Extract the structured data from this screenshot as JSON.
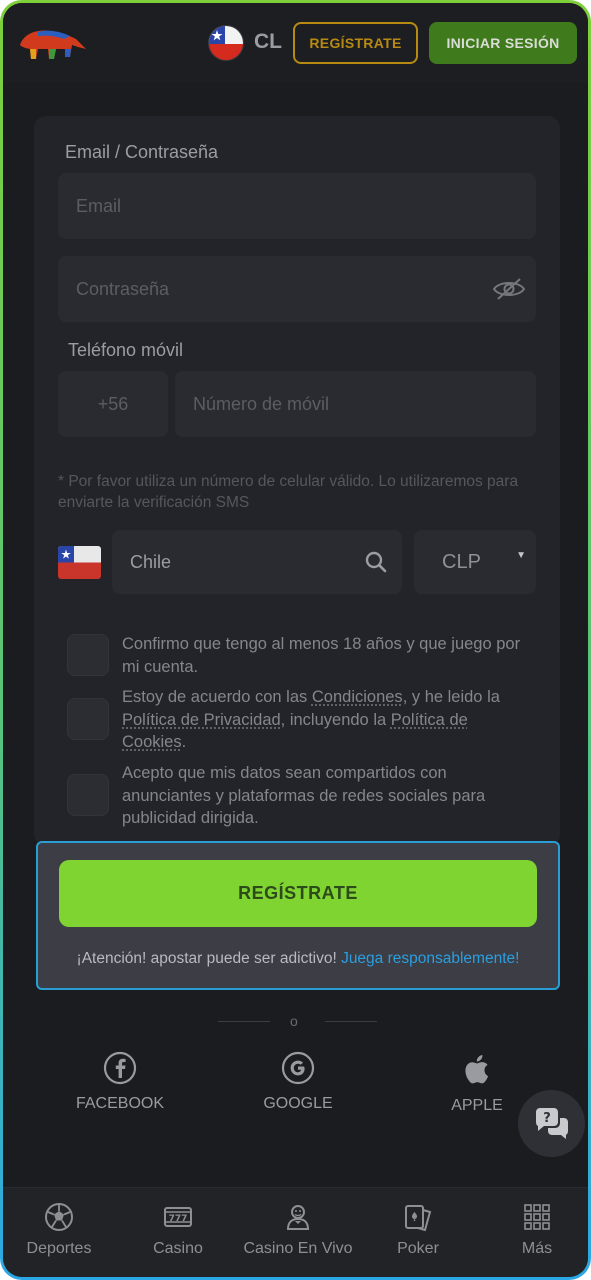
{
  "header": {
    "country_code": "CL",
    "register_label": "REGÍSTRATE",
    "login_label": "INICIAR SESIÓN"
  },
  "form": {
    "email_password_label": "Email / Contraseña",
    "email_placeholder": "Email",
    "password_placeholder": "Contraseña",
    "phone_label": "Teléfono móvil",
    "phone_prefix": "+56",
    "phone_placeholder": "Número de móvil",
    "phone_note": "* Por favor utiliza un número de celular válido. Lo utilizaremos para enviarte la verificación SMS",
    "country_value": "Chile",
    "currency_value": "CLP",
    "checks": {
      "age": "Confirmo que tengo al menos 18 años y que juego por mi cuenta.",
      "terms_part1": "Estoy de acuerdo con las ",
      "terms_link1": "Condiciones",
      "terms_part2": ", y he leido la ",
      "terms_link2": "Política de Privacidad",
      "terms_part3": ", incluyendo la ",
      "terms_link3": "Política de Cookies",
      "terms_part4": ".",
      "data_sharing": "Acepto que mis datos sean compartidos con anunciantes y plataformas de redes sociales para publicidad dirigida."
    }
  },
  "register": {
    "button_label": "REGÍSTRATE",
    "warning_text": "¡Atención! apostar puede ser adictivo! ",
    "warning_link": "Juega responsablemente!"
  },
  "social": {
    "or_label": "o",
    "facebook": "FACEBOOK",
    "google": "GOOGLE",
    "apple": "APPLE"
  },
  "nav": {
    "items": [
      {
        "label": "Deportes",
        "icon": "soccer-ball-icon"
      },
      {
        "label": "Casino",
        "icon": "slot-machine-icon"
      },
      {
        "label": "Casino En Vivo",
        "icon": "dealer-icon"
      },
      {
        "label": "Poker",
        "icon": "poker-cards-icon"
      },
      {
        "label": "Más",
        "icon": "grid-icon"
      }
    ]
  },
  "colors": {
    "accent_green": "#7fd432",
    "accent_gold": "#b78a12",
    "link_blue": "#2a9fe0",
    "background": "#1b1c20"
  }
}
